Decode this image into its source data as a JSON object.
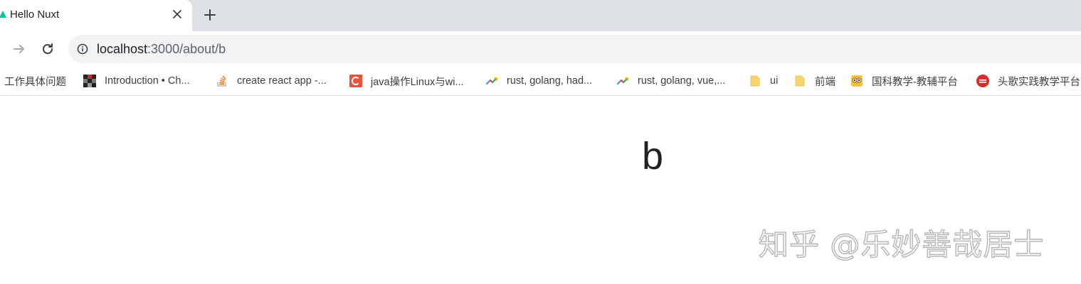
{
  "tab": {
    "title": "Hello Nuxt",
    "favicon_icon": "nuxt-logo-icon",
    "close_icon": "close-icon",
    "new_tab_icon": "plus-icon"
  },
  "toolbar": {
    "back_icon": "arrow-right-icon",
    "reload_icon": "reload-icon",
    "info_icon": "info-icon",
    "url_host": "localhost",
    "url_rest": ":3000/about/b"
  },
  "bookmarks": [
    {
      "label": "工作具体问题",
      "icon": ""
    },
    {
      "label": "Introduction • Ch...",
      "icon": "checker-icon"
    },
    {
      "label": "create react app -...",
      "icon": "stackoverflow-icon"
    },
    {
      "label": "java操作Linux与wi...",
      "icon": "c-logo-icon"
    },
    {
      "label": "rust, golang, had...",
      "icon": "trend-icon"
    },
    {
      "label": "rust, golang, vue,...",
      "icon": "trend-icon"
    },
    {
      "label": "ui",
      "icon": "folder-icon"
    },
    {
      "label": "前端",
      "icon": "folder-icon"
    },
    {
      "label": "国科教学-教辅平台",
      "icon": "owl-icon"
    },
    {
      "label": "头歌实践教学平台",
      "icon": "toge-icon"
    }
  ],
  "page": {
    "heading": "b"
  },
  "watermark": "知乎 @乐妙善哉居士",
  "colors": {
    "tab_strip": "#dee1e6",
    "omnibox": "#f1f3f4",
    "text": "#202124",
    "folder": "#f9d66c",
    "c_logo": "#e8533c",
    "toge": "#d32f2f"
  }
}
